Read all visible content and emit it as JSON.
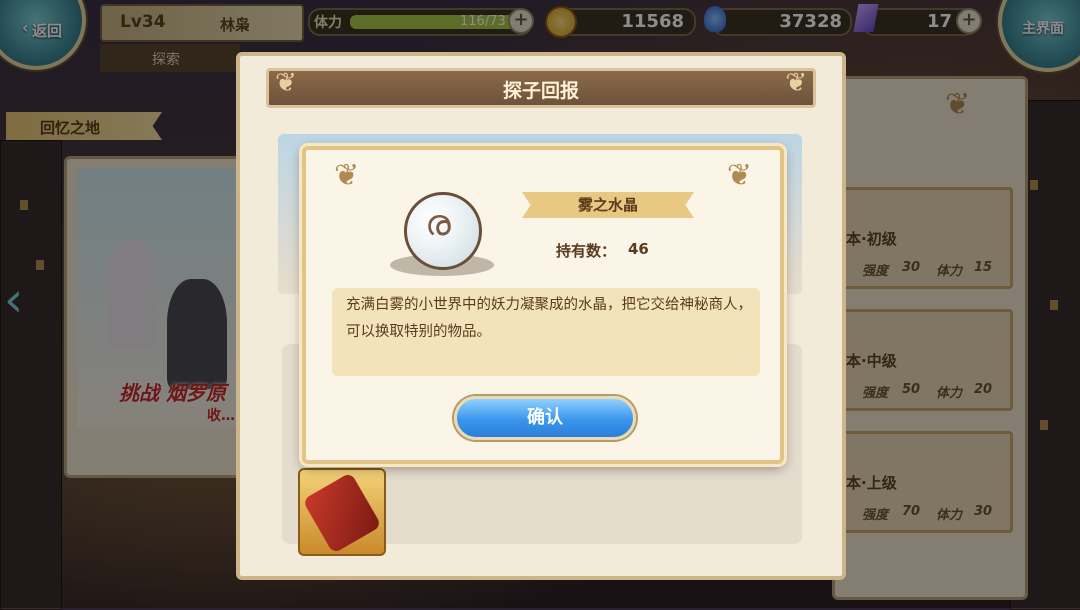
{
  "top_bar": {
    "back_label": "返回",
    "level": "Lv34",
    "player_name": "林枭",
    "location_tab": "探索",
    "stamina_label": "体力",
    "stamina_value": "116/73",
    "stamina_fill": 1.0,
    "gold": "11568",
    "soul": "37328",
    "gems": "17",
    "main_label": "主界面"
  },
  "left": {
    "area_title": "回忆之地",
    "banner_text": "挑战 烟罗原",
    "banner_sub": "收…"
  },
  "right_tiers": [
    {
      "name": "本·初级",
      "difficulty_label": "强度",
      "difficulty": "30",
      "stamina_label": "体力",
      "stamina": "15"
    },
    {
      "name": "本·中级",
      "difficulty_label": "强度",
      "difficulty": "50",
      "stamina_label": "体力",
      "stamina": "20"
    },
    {
      "name": "本·上级",
      "difficulty_label": "强度",
      "difficulty": "70",
      "stamina_label": "体力",
      "stamina": "30"
    }
  ],
  "dialog": {
    "title": "探子回报"
  },
  "popup": {
    "item_name": "雾之水晶",
    "owned_label": "持有数：",
    "owned_count": "46",
    "description": "充满白雾的小世界中的妖力凝聚成的水晶，把它交给神秘商人，可以换取特别的物品。",
    "confirm_label": "确认"
  },
  "icons": {
    "back": "back-arrow-icon",
    "gold": "gold-coin-icon",
    "soul": "blue-flame-icon",
    "gem": "crystal-gem-icon",
    "item": "mist-crystal-orb-icon",
    "reward": "red-scroll-icon"
  },
  "colors": {
    "confirm_button": "#3a96ec",
    "ribbon": "#e7c983",
    "dialog_header": "#7a5a40"
  }
}
